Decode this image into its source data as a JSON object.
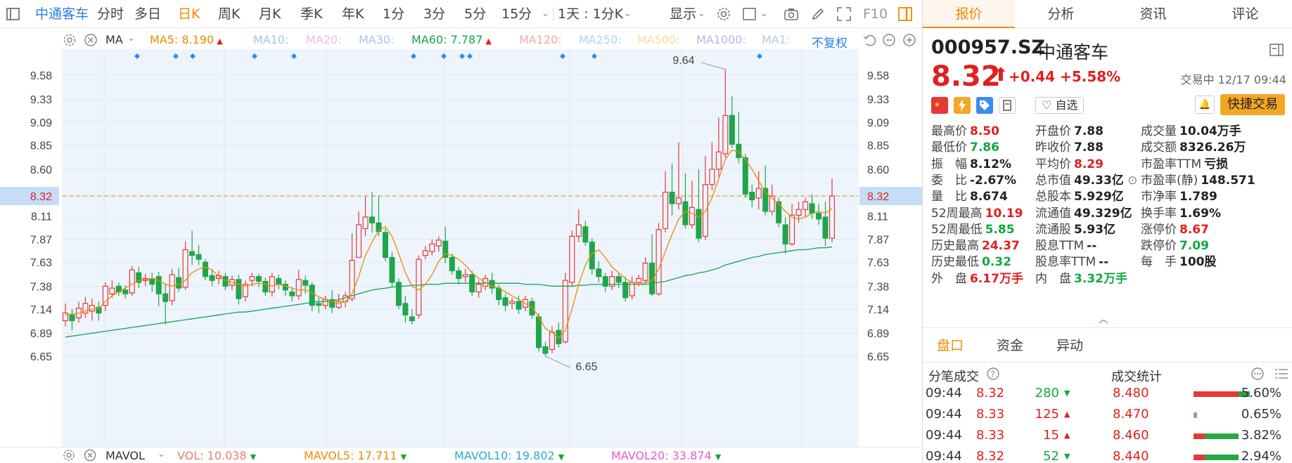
{
  "toolbar": {
    "stock_name": "中通客车",
    "periods": [
      "分时",
      "多日",
      "日K",
      "周K",
      "月K",
      "季K",
      "年K",
      "1分",
      "3分",
      "5分",
      "15分"
    ],
    "active_period": "日K",
    "range_label": "1天 : 1分K",
    "display_label": "显示",
    "f10_label": "F10"
  },
  "ma_bar": {
    "indicator": "MA",
    "items": [
      {
        "label": "MA5: 8.190",
        "color": "#f08a00",
        "arrow": "▲",
        "arrow_color": "#e0201f"
      },
      {
        "label": "MA10:",
        "color": "#9ec7f3"
      },
      {
        "label": "MA20:",
        "color": "#f1b8e4"
      },
      {
        "label": "MA30:",
        "color": "#a8c4e6"
      },
      {
        "label": "MA60: 7.787",
        "color": "#15a54e",
        "arrow": "▲",
        "arrow_color": "#e0201f"
      },
      {
        "label": "MA120:",
        "color": "#f4a7a7"
      },
      {
        "label": "MA250:",
        "color": "#a6d8f0"
      },
      {
        "label": "MA500:",
        "color": "#f7dc9e"
      },
      {
        "label": "MA1000:",
        "color": "#b6b6e8"
      },
      {
        "label": "MA1:",
        "color": "#b9c9e0"
      }
    ],
    "adjust_label": "不复权"
  },
  "chart_data": {
    "type": "candlestick",
    "y_ticks": [
      "9.58",
      "9.33",
      "9.09",
      "8.85",
      "8.60",
      "8.32",
      "8.11",
      "7.87",
      "7.63",
      "7.38",
      "7.14",
      "6.89",
      "6.65"
    ],
    "current_price": "8.32",
    "annotations": {
      "high": "9.64",
      "low": "6.65"
    },
    "ylim": [
      6.5,
      9.85
    ],
    "candles": [
      [
        7.02,
        7.1,
        6.96,
        7.2
      ],
      [
        7.08,
        7.02,
        6.92,
        7.14
      ],
      [
        7.05,
        7.15,
        7.0,
        7.22
      ],
      [
        7.1,
        7.2,
        7.05,
        7.27
      ],
      [
        7.12,
        7.18,
        7.02,
        7.25
      ],
      [
        7.16,
        7.1,
        7.02,
        7.22
      ],
      [
        7.18,
        7.38,
        7.12,
        7.42
      ],
      [
        7.3,
        7.36,
        7.26,
        7.44
      ],
      [
        7.38,
        7.32,
        7.28,
        7.42
      ],
      [
        7.34,
        7.3,
        7.25,
        7.39
      ],
      [
        7.31,
        7.55,
        7.28,
        7.59
      ],
      [
        7.52,
        7.42,
        7.36,
        7.58
      ],
      [
        7.44,
        7.46,
        7.38,
        7.51
      ],
      [
        7.46,
        7.4,
        7.32,
        7.52
      ],
      [
        7.48,
        7.3,
        7.17,
        7.53
      ],
      [
        7.3,
        7.22,
        6.98,
        7.4
      ],
      [
        7.23,
        7.5,
        7.18,
        7.56
      ],
      [
        7.47,
        7.36,
        7.32,
        7.57
      ],
      [
        7.37,
        7.76,
        7.34,
        7.85
      ],
      [
        7.74,
        7.7,
        7.6,
        7.96
      ],
      [
        7.71,
        7.66,
        7.6,
        7.81
      ],
      [
        7.63,
        7.48,
        7.44,
        7.66
      ],
      [
        7.49,
        7.44,
        7.38,
        7.55
      ],
      [
        7.46,
        7.49,
        7.4,
        7.54
      ],
      [
        7.48,
        7.38,
        7.34,
        7.52
      ],
      [
        7.39,
        7.45,
        7.34,
        7.49
      ],
      [
        7.45,
        7.25,
        7.19,
        7.5
      ],
      [
        7.27,
        7.4,
        7.22,
        7.44
      ],
      [
        7.44,
        7.48,
        7.38,
        7.52
      ],
      [
        7.48,
        7.43,
        7.37,
        7.51
      ],
      [
        7.43,
        7.32,
        7.28,
        7.47
      ],
      [
        7.32,
        7.48,
        7.27,
        7.52
      ],
      [
        7.46,
        7.4,
        7.35,
        7.5
      ],
      [
        7.4,
        7.34,
        7.28,
        7.44
      ],
      [
        7.32,
        7.28,
        7.22,
        7.37
      ],
      [
        7.28,
        7.45,
        7.24,
        7.55
      ],
      [
        7.44,
        7.39,
        7.3,
        7.49
      ],
      [
        7.39,
        7.18,
        7.12,
        7.42
      ],
      [
        7.2,
        7.18,
        7.1,
        7.26
      ],
      [
        7.18,
        7.24,
        7.14,
        7.28
      ],
      [
        7.24,
        7.16,
        7.1,
        7.34
      ],
      [
        7.16,
        7.22,
        7.14,
        7.3
      ],
      [
        7.22,
        7.28,
        7.16,
        7.32
      ],
      [
        7.25,
        7.65,
        7.22,
        7.93
      ],
      [
        7.68,
        8.02,
        7.68,
        8.16
      ],
      [
        7.98,
        8.1,
        7.9,
        8.32
      ],
      [
        8.1,
        8.04,
        7.94,
        8.36
      ],
      [
        8.04,
        7.95,
        7.9,
        8.32
      ],
      [
        7.94,
        7.68,
        7.64,
        7.98
      ],
      [
        7.68,
        7.42,
        7.38,
        7.74
      ],
      [
        7.42,
        7.18,
        7.14,
        7.46
      ],
      [
        7.2,
        7.08,
        7.0,
        7.28
      ],
      [
        7.06,
        7.02,
        6.98,
        7.14
      ],
      [
        7.08,
        7.66,
        7.04,
        7.7
      ],
      [
        7.7,
        7.75,
        7.66,
        7.8
      ],
      [
        7.74,
        7.82,
        7.7,
        7.87
      ],
      [
        7.8,
        7.86,
        7.74,
        7.9
      ],
      [
        7.85,
        7.68,
        7.62,
        8.0
      ],
      [
        7.68,
        7.54,
        7.5,
        7.72
      ],
      [
        7.54,
        7.46,
        7.4,
        7.58
      ],
      [
        7.48,
        7.5,
        7.42,
        7.56
      ],
      [
        7.5,
        7.32,
        7.28,
        7.54
      ],
      [
        7.32,
        7.4,
        7.26,
        7.44
      ],
      [
        7.38,
        7.46,
        7.34,
        7.5
      ],
      [
        7.44,
        7.36,
        7.3,
        7.52
      ],
      [
        7.36,
        7.24,
        7.18,
        7.4
      ],
      [
        7.26,
        7.18,
        7.12,
        7.3
      ],
      [
        7.2,
        7.22,
        7.14,
        7.26
      ],
      [
        7.22,
        7.14,
        7.09,
        7.28
      ],
      [
        7.16,
        7.24,
        7.12,
        7.28
      ],
      [
        7.22,
        7.08,
        7.04,
        7.26
      ],
      [
        7.06,
        6.74,
        6.7,
        7.1
      ],
      [
        6.75,
        6.68,
        6.65,
        6.8
      ],
      [
        6.72,
        6.9,
        6.68,
        6.96
      ],
      [
        6.92,
        6.78,
        6.74,
        7.0
      ],
      [
        6.8,
        7.44,
        6.78,
        7.52
      ],
      [
        7.42,
        7.9,
        7.38,
        7.96
      ],
      [
        7.9,
        8.02,
        7.84,
        8.18
      ],
      [
        8.0,
        7.84,
        7.8,
        8.06
      ],
      [
        7.84,
        7.56,
        7.5,
        7.88
      ],
      [
        7.56,
        7.48,
        7.42,
        7.64
      ],
      [
        7.48,
        7.38,
        7.32,
        7.52
      ],
      [
        7.38,
        7.48,
        7.34,
        7.54
      ],
      [
        7.48,
        7.42,
        7.36,
        7.52
      ],
      [
        7.42,
        7.26,
        7.22,
        7.48
      ],
      [
        7.28,
        7.42,
        7.24,
        7.48
      ],
      [
        7.42,
        7.46,
        7.38,
        7.5
      ],
      [
        7.44,
        7.62,
        7.4,
        7.68
      ],
      [
        7.62,
        7.3,
        7.28,
        7.92
      ],
      [
        7.3,
        7.97,
        7.28,
        8.04
      ],
      [
        7.98,
        8.36,
        7.94,
        8.58
      ],
      [
        8.36,
        8.24,
        8.12,
        8.66
      ],
      [
        8.24,
        8.3,
        8.18,
        8.88
      ],
      [
        8.26,
        8.02,
        7.98,
        8.56
      ],
      [
        8.02,
        8.2,
        7.98,
        8.48
      ],
      [
        8.18,
        7.88,
        7.84,
        8.6
      ],
      [
        7.9,
        8.44,
        7.86,
        8.74
      ],
      [
        8.44,
        8.6,
        8.38,
        8.88
      ],
      [
        8.6,
        8.78,
        8.52,
        9.14
      ],
      [
        8.76,
        9.16,
        8.72,
        9.64
      ],
      [
        9.16,
        8.86,
        8.82,
        9.36
      ],
      [
        8.86,
        8.72,
        8.66,
        9.2
      ],
      [
        8.72,
        8.34,
        8.3,
        8.76
      ],
      [
        8.36,
        8.28,
        8.2,
        8.44
      ],
      [
        8.3,
        8.4,
        8.18,
        8.58
      ],
      [
        8.4,
        8.16,
        8.12,
        8.64
      ],
      [
        8.16,
        8.32,
        8.12,
        8.44
      ],
      [
        8.26,
        8.04,
        8.0,
        8.3
      ],
      [
        8.02,
        7.82,
        7.72,
        8.1
      ],
      [
        7.82,
        8.12,
        7.8,
        8.24
      ],
      [
        8.12,
        8.18,
        8.04,
        8.26
      ],
      [
        8.18,
        8.26,
        8.1,
        8.3
      ],
      [
        8.24,
        8.14,
        8.08,
        8.34
      ],
      [
        8.14,
        8.08,
        8.02,
        8.24
      ],
      [
        8.1,
        7.88,
        7.8,
        8.26
      ],
      [
        7.88,
        8.32,
        7.84,
        8.5
      ]
    ],
    "ma5": [
      7.08,
      7.09,
      7.1,
      7.12,
      7.14,
      7.15,
      7.22,
      7.28,
      7.32,
      7.36,
      7.4,
      7.44,
      7.45,
      7.46,
      7.44,
      7.4,
      7.38,
      7.4,
      7.44,
      7.52,
      7.56,
      7.58,
      7.55,
      7.48,
      7.44,
      7.42,
      7.4,
      7.38,
      7.4,
      7.41,
      7.4,
      7.38,
      7.4,
      7.38,
      7.36,
      7.34,
      7.34,
      7.31,
      7.27,
      7.24,
      7.22,
      7.2,
      7.22,
      7.3,
      7.48,
      7.7,
      7.84,
      7.96,
      8.0,
      7.9,
      7.72,
      7.52,
      7.38,
      7.34,
      7.4,
      7.5,
      7.64,
      7.72,
      7.7,
      7.66,
      7.6,
      7.52,
      7.46,
      7.42,
      7.38,
      7.36,
      7.32,
      7.28,
      7.24,
      7.2,
      7.16,
      7.06,
      6.94,
      6.9,
      6.84,
      6.92,
      7.14,
      7.4,
      7.6,
      7.72,
      7.76,
      7.68,
      7.58,
      7.52,
      7.46,
      7.42,
      7.4,
      7.42,
      7.44,
      7.56,
      7.74,
      7.92,
      8.08,
      8.16,
      8.14,
      8.1,
      8.16,
      8.3,
      8.5,
      8.7,
      8.8,
      8.78,
      8.7,
      8.6,
      8.48,
      8.36,
      8.3,
      8.24,
      8.16,
      8.1,
      8.08,
      8.1,
      8.14,
      8.16,
      8.14,
      8.19
    ],
    "ma60": [
      6.85,
      6.86,
      6.87,
      6.88,
      6.89,
      6.9,
      6.91,
      6.92,
      6.93,
      6.94,
      6.95,
      6.96,
      6.97,
      6.98,
      6.99,
      7.0,
      7.01,
      7.02,
      7.03,
      7.04,
      7.05,
      7.06,
      7.07,
      7.08,
      7.09,
      7.1,
      7.11,
      7.11,
      7.12,
      7.13,
      7.14,
      7.15,
      7.16,
      7.17,
      7.18,
      7.19,
      7.2,
      7.21,
      7.22,
      7.22,
      7.23,
      7.24,
      7.26,
      7.28,
      7.3,
      7.32,
      7.34,
      7.35,
      7.36,
      7.37,
      7.38,
      7.38,
      7.39,
      7.39,
      7.4,
      7.4,
      7.4,
      7.41,
      7.41,
      7.41,
      7.41,
      7.41,
      7.41,
      7.41,
      7.41,
      7.41,
      7.41,
      7.41,
      7.41,
      7.4,
      7.4,
      7.4,
      7.39,
      7.38,
      7.38,
      7.38,
      7.38,
      7.39,
      7.39,
      7.4,
      7.4,
      7.4,
      7.4,
      7.4,
      7.4,
      7.4,
      7.4,
      7.4,
      7.41,
      7.42,
      7.43,
      7.45,
      7.47,
      7.49,
      7.5,
      7.52,
      7.53,
      7.55,
      7.57,
      7.6,
      7.62,
      7.64,
      7.66,
      7.68,
      7.69,
      7.71,
      7.72,
      7.73,
      7.74,
      7.75,
      7.76,
      7.76,
      7.77,
      7.78,
      7.78,
      7.79
    ]
  },
  "vol_bar": {
    "indicator": "MAVOL",
    "items": [
      {
        "label": "VOL: 10.038",
        "color": "#f07a7a"
      },
      {
        "label": "MAVOL5: 17.711",
        "color": "#f08a00"
      },
      {
        "label": "MAVOL10: 19.802",
        "color": "#2aa7d8"
      },
      {
        "label": "MAVOL20: 33.874",
        "color": "#e05cc9"
      }
    ]
  },
  "panel": {
    "tabs": [
      "报价",
      "分析",
      "资讯",
      "评论"
    ],
    "code": "000957.SZ",
    "name": "中通客车",
    "price": "8.32",
    "change": "+0.44 +5.58%",
    "status": "交易中 12/17 09:44",
    "fav_label": "自选",
    "fast_trade": "快捷交易",
    "quote": [
      [
        {
          "k": "最高价",
          "v": "8.50",
          "c": "red"
        },
        {
          "k": "开盘价",
          "v": "7.88",
          "c": "dark"
        },
        {
          "k": "成交量",
          "v": "10.04万手",
          "c": "dark"
        }
      ],
      [
        {
          "k": "最低价",
          "v": "7.86",
          "c": "green"
        },
        {
          "k": "昨收价",
          "v": "7.88",
          "c": "dark"
        },
        {
          "k": "成交额",
          "v": "8326.26万",
          "c": "dark"
        }
      ],
      [
        {
          "k": "振　幅",
          "v": "8.12%",
          "c": "dark"
        },
        {
          "k": "平均价",
          "v": "8.29",
          "c": "red"
        },
        {
          "k": "市盈率TTM",
          "v": "亏损",
          "c": "dark"
        }
      ],
      [
        {
          "k": "委　比",
          "v": "-2.67%",
          "c": "dark"
        },
        {
          "k": "总市值",
          "v": "49.33亿",
          "c": "dark"
        },
        {
          "k": "市盈率(静)",
          "v": "148.571",
          "c": "dark"
        }
      ],
      [
        {
          "k": "量　比",
          "v": "8.674",
          "c": "dark"
        },
        {
          "k": "总股本",
          "v": "5.929亿",
          "c": "dark"
        },
        {
          "k": "市净率",
          "v": "1.789",
          "c": "dark"
        }
      ],
      [
        {
          "k": "52周最高",
          "v": "10.19",
          "c": "red"
        },
        {
          "k": "流通值",
          "v": "49.329亿",
          "c": "dark"
        },
        {
          "k": "换手率",
          "v": "1.69%",
          "c": "dark"
        }
      ],
      [
        {
          "k": "52周最低",
          "v": "5.85",
          "c": "green"
        },
        {
          "k": "流通股",
          "v": "5.93亿",
          "c": "dark"
        },
        {
          "k": "涨停价",
          "v": "8.67",
          "c": "red"
        }
      ],
      [
        {
          "k": "历史最高",
          "v": "24.37",
          "c": "red"
        },
        {
          "k": "股息TTM",
          "v": "--",
          "c": "dark"
        },
        {
          "k": "跌停价",
          "v": "7.09",
          "c": "green"
        }
      ],
      [
        {
          "k": "历史最低",
          "v": "0.32",
          "c": "green"
        },
        {
          "k": "股息率TTM",
          "v": "--",
          "c": "dark"
        },
        {
          "k": "每　手",
          "v": "100股",
          "c": "dark"
        }
      ],
      [
        {
          "k": "外　盘",
          "v": "6.17万手",
          "c": "red"
        },
        {
          "k": "内　盘",
          "v": "3.32万手",
          "c": "green"
        }
      ]
    ],
    "subtabs": [
      "盘口",
      "资金",
      "异动"
    ],
    "trades_title": "分笔成交",
    "stats_title": "成交统计",
    "trades": [
      {
        "time": "09:44",
        "price": "8.32",
        "vol": "280",
        "dir": "down",
        "sp": "8.480",
        "pct": "5.60%",
        "red": 0.8,
        "green": 0.2
      },
      {
        "time": "09:44",
        "price": "8.33",
        "vol": "125",
        "dir": "up",
        "sp": "8.470",
        "pct": "0.65%",
        "red": 0,
        "green": 0.05
      },
      {
        "time": "09:44",
        "price": "8.33",
        "vol": "15",
        "dir": "up",
        "sp": "8.460",
        "pct": "3.82%",
        "red": 0.2,
        "green": 0.6
      },
      {
        "time": "09:44",
        "price": "8.32",
        "vol": "52",
        "dir": "down",
        "sp": "8.440",
        "pct": "2.94%",
        "red": 0.2,
        "green": 0.6
      }
    ]
  }
}
